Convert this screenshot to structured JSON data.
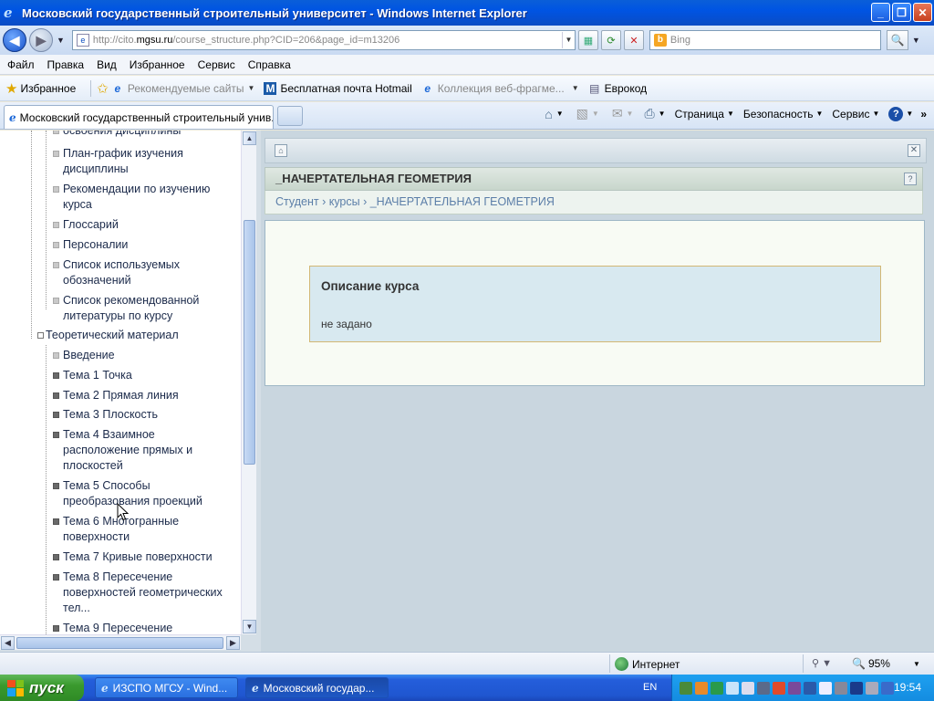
{
  "window": {
    "title": "Московский государственный строительный университет - Windows Internet Explorer",
    "controls": {
      "minimize": "_",
      "maximize": "❐",
      "close": "✕"
    }
  },
  "address_bar": {
    "url_prefix": "http://cito.",
    "url_domain": "mgsu.ru",
    "url_path": "/course_structure.php?CID=206&page_id=m13206",
    "search_placeholder": "Bing"
  },
  "menu": {
    "items": [
      "Файл",
      "Правка",
      "Вид",
      "Избранное",
      "Сервис",
      "Справка"
    ]
  },
  "favorites_bar": {
    "favorites_label": "Избранное",
    "items": [
      {
        "label": "Рекомендуемые сайты",
        "icon": "ie-icon",
        "dim": true
      },
      {
        "label": "Бесплатная почта Hotmail",
        "icon": "hotmail-icon",
        "dim": false
      },
      {
        "label": "Коллекция веб-фрагме...",
        "icon": "ie-icon",
        "dim": true
      },
      {
        "label": "Еврокод",
        "icon": "eurocode-icon",
        "dim": false
      }
    ]
  },
  "tabs": {
    "active_tab": "Московский государственный строительный унив..."
  },
  "command_bar": {
    "page": "Страница",
    "security": "Безопасность",
    "tools": "Сервис"
  },
  "tree": {
    "items": [
      {
        "text": "освоения дисциплины",
        "level": 2,
        "bullet": "light"
      },
      {
        "text": "План-график изучения дисциплины",
        "level": 2,
        "bullet": "light"
      },
      {
        "text": "Рекомендации по изучению курса",
        "level": 2,
        "bullet": "light"
      },
      {
        "text": "Глоссарий",
        "level": 2,
        "bullet": "light"
      },
      {
        "text": "Персоналии",
        "level": 2,
        "bullet": "light"
      },
      {
        "text": "Список используемых обозначений",
        "level": 2,
        "bullet": "light"
      },
      {
        "text": "Список рекомендованной литературы по курсу",
        "level": 2,
        "bullet": "light"
      },
      {
        "text": "Теоретический материал",
        "level": 1,
        "bullet": "box"
      },
      {
        "text": "Введение",
        "level": 2,
        "bullet": "light"
      },
      {
        "text": "Тема 1 Точка",
        "level": 2,
        "bullet": "dark"
      },
      {
        "text": "Тема 2 Прямая линия",
        "level": 2,
        "bullet": "dark"
      },
      {
        "text": "Тема 3 Плоскость",
        "level": 2,
        "bullet": "dark"
      },
      {
        "text": "Тема 4 Взаимное расположение прямых и плоскостей",
        "level": 2,
        "bullet": "dark"
      },
      {
        "text": "Тема 5 Способы преобразования проекций",
        "level": 2,
        "bullet": "dark"
      },
      {
        "text": "Тема 6 Многогранные поверхности",
        "level": 2,
        "bullet": "dark"
      },
      {
        "text": "Тема 7 Кривые поверхности",
        "level": 2,
        "bullet": "dark"
      },
      {
        "text": "Тема 8 Пересечение поверхностей геометрических тел...",
        "level": 2,
        "bullet": "dark"
      },
      {
        "text": "Тема 9 Пересечение",
        "level": 2,
        "bullet": "dark"
      }
    ]
  },
  "course": {
    "header": "_НАЧЕРТАТЕЛЬНАЯ ГЕОМЕТРИЯ",
    "breadcrumb": "Студент › курсы › _НАЧЕРТАТЕЛЬНАЯ ГЕОМЕТРИЯ",
    "description_title": "Описание курса",
    "description_text": "не задано"
  },
  "status_bar": {
    "zone": "Интернет",
    "zoom": "95%"
  },
  "taskbar": {
    "start": "пуск",
    "items": [
      "ИЗСПО МГСУ - Wind...",
      "Московский государ..."
    ],
    "language": "EN",
    "clock": "19:54"
  },
  "colors": {
    "title_blue": "#0054e3",
    "link_blue": "#5b7ea8",
    "taskbar_blue": "#245edb",
    "start_green": "#3a9a2e"
  }
}
